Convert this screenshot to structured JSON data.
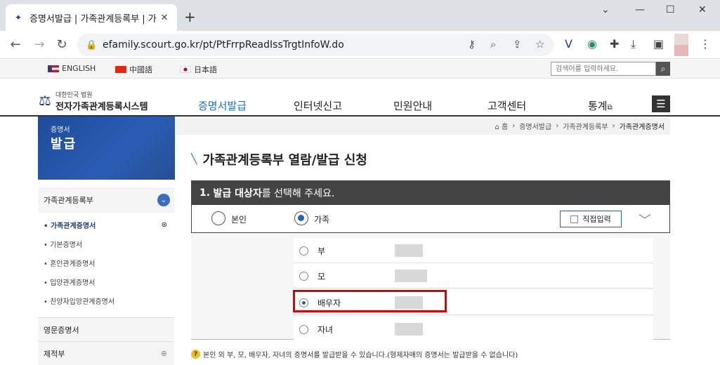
{
  "browser": {
    "tab_title": "증명서발급 | 가족관계등록부 | 가",
    "tab_close": "✕",
    "new_tab": "+",
    "url": "efamily.scourt.go.kr/pt/PtFrrpReadIssTrgtInfoW.do",
    "win_minimize": "⌄",
    "win_min": "—",
    "win_max": "☐",
    "win_close": "✕"
  },
  "langs": [
    {
      "label": "ENGLISH"
    },
    {
      "label": "中國語"
    },
    {
      "label": "日本語"
    }
  ],
  "search": {
    "placeholder": "검색어를 입력하세요."
  },
  "logo": {
    "line1": "대한민국 법원",
    "line2": "전자가족관계등록시스템"
  },
  "gnb": [
    {
      "label": "증명서발급"
    },
    {
      "label": "인터넷신고"
    },
    {
      "label": "민원안내"
    },
    {
      "label": "고객센터"
    },
    {
      "label": "통계"
    }
  ],
  "banner": {
    "line1": "증명서",
    "line2": "발급"
  },
  "lnb": {
    "head": "가족관계등록부",
    "items": [
      {
        "label": "• 가족관계증명서"
      },
      {
        "label": "• 기본증명서"
      },
      {
        "label": "• 혼인관계증명서"
      },
      {
        "label": "• 입양관계증명서"
      },
      {
        "label": "• 친양자입양관계증명서"
      }
    ],
    "sec1": "영문증명서",
    "sec2": "제적부"
  },
  "breadcrumb": {
    "home": "⌂ 홈",
    "c1": "증명서발급",
    "c2": "가족관계등록부",
    "current": "가족관계증명서",
    "sep": "›"
  },
  "page_title": "가족관계등록부 열람/발급 신청",
  "step": {
    "num": "1.",
    "bold": "발급 대상자",
    "rest": "를 선택해 주세요."
  },
  "choice": {
    "self": "본인",
    "family": "가족",
    "direct": "직접입력",
    "selected": "family"
  },
  "family": [
    {
      "label": "부",
      "selected": false
    },
    {
      "label": "모",
      "selected": false
    },
    {
      "label": "배우자",
      "selected": true
    },
    {
      "label": "자녀",
      "selected": false
    }
  ],
  "notice": "본인 외 부, 모, 배우자, 자녀의 증명서를 발급받을 수 있습니다.(형제자매의 증명서는 발급받을 수 없습니다)"
}
